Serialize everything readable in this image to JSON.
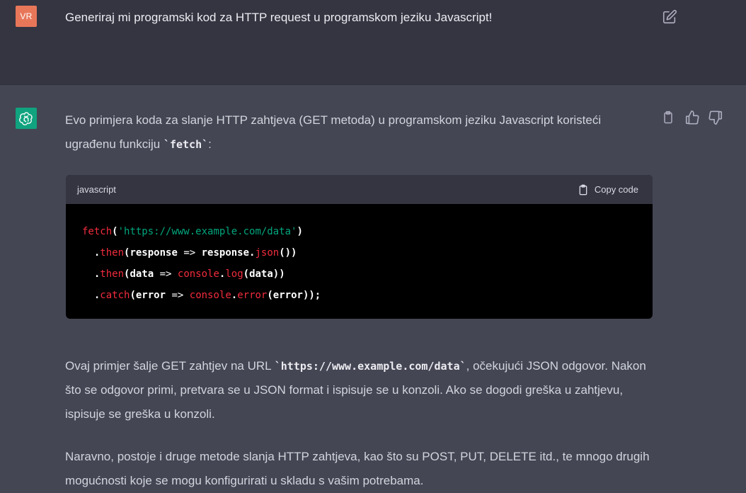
{
  "user_message": {
    "avatar_initials": "VR",
    "text": "Generiraj mi programski kod za HTTP request u programskom jeziku Javascript!",
    "edit_icon": "edit-icon"
  },
  "assistant_message": {
    "avatar_icon": "openai-logo-icon",
    "intro_text_1": "Evo primjera koda za slanje HTTP zahtjeva (GET metoda) u programskom jeziku Javascript koristeći ugrađenu funkciju ",
    "intro_code": "`fetch`",
    "intro_text_2": ":",
    "code_block": {
      "language": "javascript",
      "copy_label": "Copy code",
      "lines": [
        [
          {
            "t": "fetch",
            "c": "fn"
          },
          {
            "t": "(",
            "c": "plain"
          },
          {
            "t": "'https://www.example.com/data'",
            "c": "str"
          },
          {
            "t": ")",
            "c": "plain"
          }
        ],
        [
          {
            "t": "  .",
            "c": "plain"
          },
          {
            "t": "then",
            "c": "fn"
          },
          {
            "t": "(response ",
            "c": "plain"
          },
          {
            "t": "=>",
            "c": "op"
          },
          {
            "t": " response.",
            "c": "plain"
          },
          {
            "t": "json",
            "c": "fn"
          },
          {
            "t": "())",
            "c": "plain"
          }
        ],
        [
          {
            "t": "  .",
            "c": "plain"
          },
          {
            "t": "then",
            "c": "fn"
          },
          {
            "t": "(data ",
            "c": "plain"
          },
          {
            "t": "=>",
            "c": "op"
          },
          {
            "t": " ",
            "c": "plain"
          },
          {
            "t": "console",
            "c": "fn"
          },
          {
            "t": ".",
            "c": "plain"
          },
          {
            "t": "log",
            "c": "fn"
          },
          {
            "t": "(data))",
            "c": "plain"
          }
        ],
        [
          {
            "t": "  .",
            "c": "plain"
          },
          {
            "t": "catch",
            "c": "fn"
          },
          {
            "t": "(error ",
            "c": "plain"
          },
          {
            "t": "=>",
            "c": "op"
          },
          {
            "t": " ",
            "c": "plain"
          },
          {
            "t": "console",
            "c": "fn"
          },
          {
            "t": ".",
            "c": "plain"
          },
          {
            "t": "error",
            "c": "fn"
          },
          {
            "t": "(error));",
            "c": "plain"
          }
        ]
      ]
    },
    "para2_text_1": "Ovaj primjer šalje GET zahtjev na URL ",
    "para2_code": "`https://www.example.com/data`",
    "para2_text_2": ", očekujući JSON odgovor. Nakon što se odgovor primi, pretvara se u JSON format i ispisuje se u konzoli. Ako se dogodi greška u zahtjevu, ispisuje se greška u konzoli.",
    "para3_text": "Naravno, postoje i druge metode slanja HTTP zahtjeva, kao što su POST, PUT, DELETE itd., te mnogo drugih mogućnosti koje se mogu konfigurirati u skladu s vašim potrebama.",
    "actions": [
      "copy-icon",
      "thumbs-up-icon",
      "thumbs-down-icon"
    ]
  },
  "colors": {
    "user_bg": "#343541",
    "assistant_bg": "#444654",
    "user_avatar": "#e8775a",
    "bot_avatar": "#10a37f",
    "code_bg": "#000000",
    "code_header_bg": "#343541",
    "token_function": "#f22c3d",
    "token_string": "#00a67d"
  }
}
